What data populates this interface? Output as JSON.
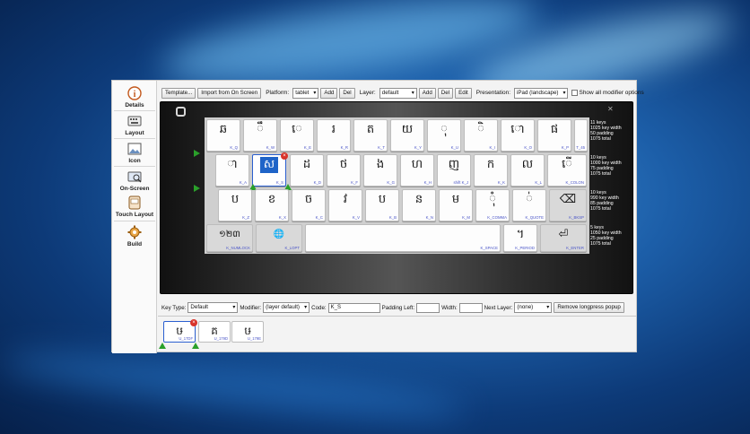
{
  "sidebar": {
    "items": [
      {
        "label": "Details",
        "icon": "info-icon"
      },
      {
        "label": "Layout",
        "icon": "layout-icon"
      },
      {
        "label": "Icon",
        "icon": "image-icon"
      },
      {
        "label": "On-Screen",
        "icon": "on-screen-keyboard-icon"
      },
      {
        "label": "Touch Layout",
        "icon": "touch-layout-icon"
      },
      {
        "label": "Build",
        "icon": "gear-icon"
      }
    ]
  },
  "toolbar": {
    "template_label": "Template...",
    "import_label": "Import from On Screen",
    "platform_label": "Platform:",
    "platform_value": "tablet",
    "add_label": "Add",
    "del_label": "Del",
    "layer_label": "Layer:",
    "layer_value": "default",
    "edit_label": "Edit",
    "presentation_label": "Presentation:",
    "presentation_value": "iPad (landscape)",
    "show_modifiers_label": "Show all modifier options"
  },
  "keyboard": {
    "rows": [
      {
        "info": [
          "11 keys",
          "1025 key width",
          "50 padding",
          "1075 total"
        ]
      },
      {
        "info": [
          "10 keys",
          "1000 key width",
          "75 padding",
          "1075 total"
        ]
      },
      {
        "info": [
          "10 keys",
          "990 key width",
          "85 padding",
          "1075 total"
        ]
      },
      {
        "info": [
          "5 keys",
          "1050 key width",
          "25 padding",
          "1075 total"
        ]
      }
    ],
    "row1": [
      {
        "cap": "ឆ",
        "id": "K_Q"
      },
      {
        "cap": "ឹ",
        "id": "K_W"
      },
      {
        "cap": "េ",
        "id": "K_E"
      },
      {
        "cap": "រ",
        "id": "K_R"
      },
      {
        "cap": "ត",
        "id": "K_T"
      },
      {
        "cap": "យ",
        "id": "K_Y"
      },
      {
        "cap": "ុ",
        "id": "K_U"
      },
      {
        "cap": "ិ",
        "id": "K_I"
      },
      {
        "cap": "ោ",
        "id": "K_O"
      },
      {
        "cap": "ផ",
        "id": "K_P"
      },
      {
        "cap": "",
        "id": "T_45"
      }
    ],
    "row2": [
      {
        "cap": "ា",
        "id": "K_A"
      },
      {
        "cap": "ស",
        "id": "K_S"
      },
      {
        "cap": "ដ",
        "id": "K_D"
      },
      {
        "cap": "ថ",
        "id": "K_F"
      },
      {
        "cap": "ង",
        "id": "K_G"
      },
      {
        "cap": "ហ",
        "id": "K_H"
      },
      {
        "cap": "ញ",
        "id": "shift K_J"
      },
      {
        "cap": "ក",
        "id": "K_K"
      },
      {
        "cap": "ល",
        "id": "K_L"
      },
      {
        "cap": "ើ",
        "id": "K_COLON"
      }
    ],
    "row3": [
      {
        "cap": "ប",
        "id": "K_Z"
      },
      {
        "cap": "ខ",
        "id": "K_X"
      },
      {
        "cap": "ច",
        "id": "K_C"
      },
      {
        "cap": "វ",
        "id": "K_V"
      },
      {
        "cap": "ប",
        "id": "K_B"
      },
      {
        "cap": "ន",
        "id": "K_N"
      },
      {
        "cap": "ម",
        "id": "K_M"
      },
      {
        "cap": "ុំ",
        "id": "K_COMMA"
      },
      {
        "cap": "់",
        "id": "K_QUOTE"
      },
      {
        "cap": "⌫",
        "id": "K_BKSP"
      }
    ],
    "row4": [
      {
        "cap": "១២៣",
        "id": "K_NUMLOCK"
      },
      {
        "cap": "🌐",
        "id": "K_LOPT"
      },
      {
        "cap": "",
        "id": "K_SPACE"
      },
      {
        "cap": "។",
        "id": "K_PERIOD"
      },
      {
        "cap": "⏎",
        "id": "K_ENTER"
      }
    ]
  },
  "props": {
    "key_type_label": "Key Type:",
    "key_type_value": "Default",
    "modifier_label": "Modifier:",
    "modifier_value": "(layer default)",
    "code_label": "Code:",
    "code_value": "K_S",
    "padding_left_label": "Padding Left:",
    "padding_left_value": "",
    "width_label": "Width:",
    "width_value": "",
    "next_layer_label": "Next Layer:",
    "next_layer_value": "(none)",
    "remove_longpress_label": "Remove longpress popup"
  },
  "longpress": [
    {
      "cap": "ឞ",
      "id": "U_17DF"
    },
    {
      "cap": "គ",
      "id": "U_179D"
    },
    {
      "cap": "ឞ",
      "id": "U_179E"
    }
  ],
  "colors": {
    "accent": "#2b5fd0",
    "delete": "#d8332a",
    "marker": "#2aa02a"
  }
}
